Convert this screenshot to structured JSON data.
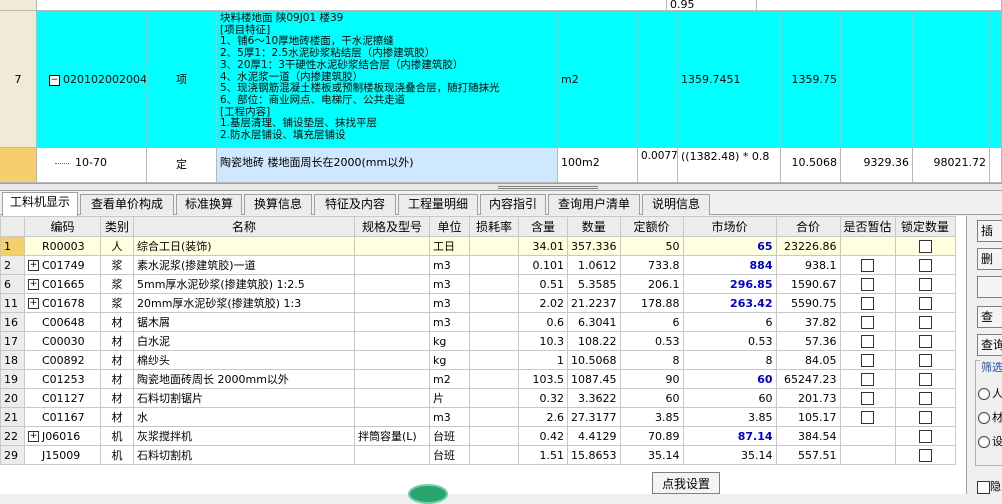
{
  "top_grid": {
    "partial_row": {
      "value": "0.95"
    },
    "row7": {
      "row_no": "7",
      "code": "020102002004",
      "category": "项",
      "desc_lines": [
        "块料楼地面  陕09J01  楼39",
        "[项目特征]",
        "1、铺6～10厚地砖楼面，干水泥擦缝",
        "2、5厚1：2.5水泥砂浆粘结层（内掺建筑胶）",
        "3、20厚1：3干硬性水泥砂浆结合层（内掺建筑胶）",
        "4、水泥浆一道（内掺建筑胶）",
        "5、现浇钢筋混凝土楼板或预制楼板现浇叠合层，随打随抹光",
        "6、部位：商业网点、电梯厅、公共走道",
        "[工程内容]",
        "1.基层清理、铺设垫层、抹找平层",
        "2.防水层铺设、填充层铺设"
      ],
      "unit": "m2",
      "quantity": "1359.7451",
      "quantity2": "1359.75"
    },
    "row8": {
      "code": "10-70",
      "category": "定",
      "desc": "陶瓷地砖 楼地面周长在2000(mm以外)",
      "unit": "100m2",
      "coef": "0.0077",
      "formula": "((1382.48) * 0.8",
      "qty": "10.5068",
      "price": "9329.36",
      "total": "98021.72"
    }
  },
  "tabs": [
    "工料机显示",
    "查看单价构成",
    "标准换算",
    "换算信息",
    "特征及内容",
    "工程量明细",
    "内容指引",
    "查询用户清单",
    "说明信息"
  ],
  "table": {
    "headers": [
      "编码",
      "类别",
      "名称",
      "规格及型号",
      "单位",
      "损耗率",
      "含量",
      "数量",
      "定额价",
      "市场价",
      "合价",
      "是否暂估",
      "锁定数量"
    ],
    "rows": [
      {
        "rn": "1",
        "expand": false,
        "code": "R00003",
        "type": "人",
        "name": "综合工日(装饰)",
        "spec": "",
        "unit": "工日",
        "loss": "",
        "content": "34.01",
        "qty": "357.336",
        "base": "50",
        "market": "65",
        "mblue": true,
        "total": "23226.86",
        "est": false,
        "lock": true
      },
      {
        "rn": "2",
        "expand": true,
        "code": "C01749",
        "type": "浆",
        "name": "素水泥浆(掺建筑胶)一道",
        "spec": "",
        "unit": "m3",
        "loss": "",
        "content": "0.101",
        "qty": "1.0612",
        "base": "733.8",
        "market": "884",
        "mblue": true,
        "total": "938.1",
        "est": true,
        "lock": true
      },
      {
        "rn": "6",
        "expand": true,
        "code": "C01665",
        "type": "浆",
        "name": "5mm厚水泥砂浆(掺建筑胶) 1:2.5",
        "spec": "",
        "unit": "m3",
        "loss": "",
        "content": "0.51",
        "qty": "5.3585",
        "base": "206.1",
        "market": "296.85",
        "mblue": true,
        "total": "1590.67",
        "est": true,
        "lock": true
      },
      {
        "rn": "11",
        "expand": true,
        "code": "C01678",
        "type": "浆",
        "name": "20mm厚水泥砂浆(掺建筑胶) 1:3",
        "spec": "",
        "unit": "m3",
        "loss": "",
        "content": "2.02",
        "qty": "21.2237",
        "base": "178.88",
        "market": "263.42",
        "mblue": true,
        "total": "5590.75",
        "est": true,
        "lock": true
      },
      {
        "rn": "16",
        "expand": false,
        "code": "C00648",
        "type": "材",
        "name": "锯木屑",
        "spec": "",
        "unit": "m3",
        "loss": "",
        "content": "0.6",
        "qty": "6.3041",
        "base": "6",
        "market": "6",
        "mblue": false,
        "total": "37.82",
        "est": true,
        "lock": true
      },
      {
        "rn": "17",
        "expand": false,
        "code": "C00030",
        "type": "材",
        "name": "白水泥",
        "spec": "",
        "unit": "kg",
        "loss": "",
        "content": "10.3",
        "qty": "108.22",
        "base": "0.53",
        "market": "0.53",
        "mblue": false,
        "total": "57.36",
        "est": true,
        "lock": true
      },
      {
        "rn": "18",
        "expand": false,
        "code": "C00892",
        "type": "材",
        "name": "棉纱头",
        "spec": "",
        "unit": "kg",
        "loss": "",
        "content": "1",
        "qty": "10.5068",
        "base": "8",
        "market": "8",
        "mblue": false,
        "total": "84.05",
        "est": true,
        "lock": true
      },
      {
        "rn": "19",
        "expand": false,
        "code": "C01253",
        "type": "材",
        "name": "陶瓷地面砖周长 2000mm以外",
        "spec": "",
        "unit": "m2",
        "loss": "",
        "content": "103.5",
        "qty": "1087.45",
        "base": "90",
        "market": "60",
        "mblue": true,
        "total": "65247.23",
        "est": true,
        "lock": true
      },
      {
        "rn": "20",
        "expand": false,
        "code": "C01127",
        "type": "材",
        "name": "石料切割锯片",
        "spec": "",
        "unit": "片",
        "loss": "",
        "content": "0.32",
        "qty": "3.3622",
        "base": "60",
        "market": "60",
        "mblue": false,
        "total": "201.73",
        "est": true,
        "lock": true
      },
      {
        "rn": "21",
        "expand": false,
        "code": "C01167",
        "type": "材",
        "name": "水",
        "spec": "",
        "unit": "m3",
        "loss": "",
        "content": "2.6",
        "qty": "27.3177",
        "base": "3.85",
        "market": "3.85",
        "mblue": false,
        "total": "105.17",
        "est": true,
        "lock": true
      },
      {
        "rn": "22",
        "expand": true,
        "code": "J06016",
        "type": "机",
        "name": "灰浆搅拌机",
        "spec": "拌筒容量(L)",
        "unit": "台班",
        "loss": "",
        "content": "0.42",
        "qty": "4.4129",
        "base": "70.89",
        "market": "87.14",
        "mblue": true,
        "total": "384.54",
        "est": false,
        "lock": true
      },
      {
        "rn": "29",
        "expand": false,
        "code": "J15009",
        "type": "机",
        "name": "石料切割机",
        "spec": "",
        "unit": "台班",
        "loss": "",
        "content": "1.51",
        "qty": "15.8653",
        "base": "35.14",
        "market": "35.14",
        "mblue": false,
        "total": "557.51",
        "est": false,
        "lock": true
      }
    ]
  },
  "right_panel": {
    "buttons": [
      "插",
      "删",
      "",
      "查",
      "查询"
    ],
    "filter_title": "筛选",
    "radios": [
      "人",
      "材",
      "设"
    ],
    "bottom_check": "隐"
  },
  "setting_button": "点我设置",
  "colors": {
    "highlight": "#00ffff",
    "market_blue": "#0000cc"
  }
}
